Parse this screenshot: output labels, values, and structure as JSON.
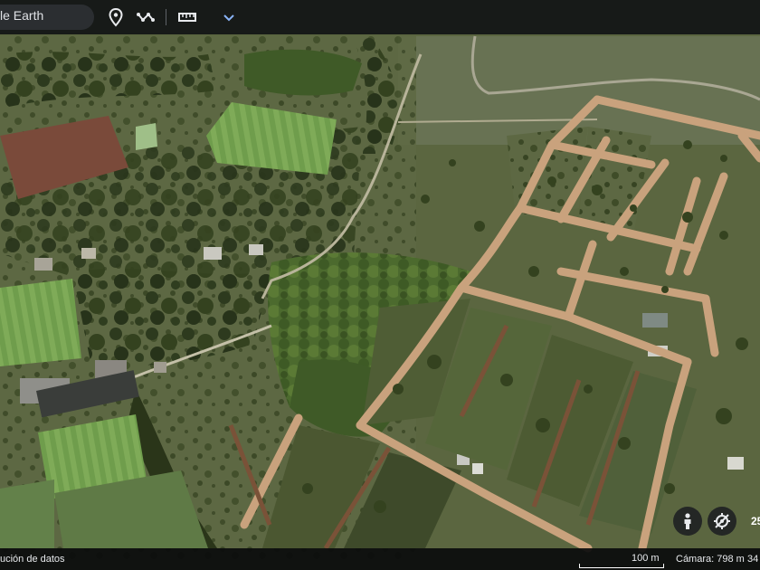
{
  "toolbar": {
    "search_text": "le Earth",
    "icons": [
      "place-marker-icon",
      "path-icon",
      "ruler-icon",
      "chevron-down-icon"
    ]
  },
  "status": {
    "attribution": "ución de datos",
    "scale": "100 m",
    "camera": "Cámara: 798 m",
    "extra": "34"
  },
  "controls": {
    "icons": [
      "pegman-icon",
      "reset-orientation-icon"
    ],
    "partial_number": "25"
  },
  "colors": {
    "terrain": "#5b6640",
    "dirt_road": "#c9a27d",
    "trees": "#2f3d1f",
    "sport_field": "#6b9a4a",
    "clay_court": "#7a4a3a"
  }
}
